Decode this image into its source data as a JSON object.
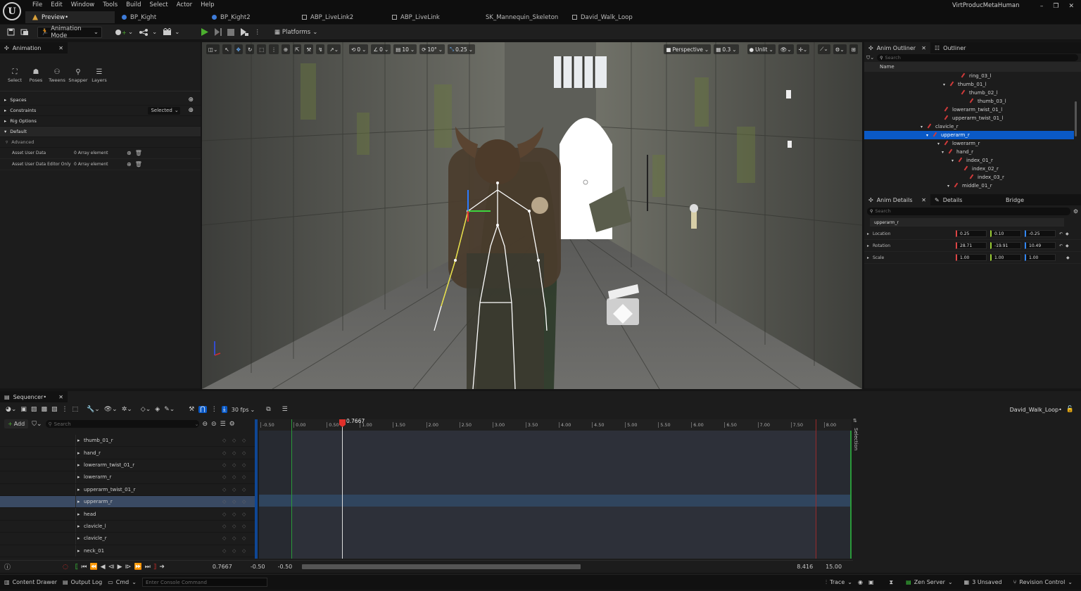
{
  "window": {
    "title": "VirtProducMetaHuman"
  },
  "menu": [
    "File",
    "Edit",
    "Window",
    "Tools",
    "Build",
    "Select",
    "Actor",
    "Help"
  ],
  "tabs": [
    {
      "label": "Preview•"
    },
    {
      "label": "BP_Kight"
    },
    {
      "label": "BP_Kight2"
    },
    {
      "label": "ABP_LiveLink2"
    },
    {
      "label": "ABP_LiveLink"
    },
    {
      "label": "SK_Mannequin_Skeleton"
    },
    {
      "label": "David_Walk_Loop"
    }
  ],
  "toolbar": {
    "mode_label": "Animation Mode",
    "platforms_label": "Platforms"
  },
  "animation_panel": {
    "tab_label": "Animation",
    "tools": [
      {
        "label": "Select"
      },
      {
        "label": "Poses"
      },
      {
        "label": "Tweens"
      },
      {
        "label": "Snapper"
      },
      {
        "label": "Layers"
      }
    ],
    "sections": {
      "spaces": "Spaces",
      "constraints": "Constraints",
      "constraints_value": "Selected",
      "rig_options": "Rig Options",
      "default": "Default",
      "advanced": "Advanced"
    },
    "props": [
      {
        "name": "Asset User Data",
        "value": "0 Array element"
      },
      {
        "name": "Asset User Data Editor Only",
        "value": "0 Array element"
      }
    ]
  },
  "viewport": {
    "perspective_label": "Perspective",
    "lit_label": "Unlit",
    "snap_translate": "10",
    "snap_rotate": "10°",
    "snap_scale": "0.25",
    "camera_speed": "0.3",
    "rotation_snap_label": "0"
  },
  "anim_outliner": {
    "tab_label": "Anim Outliner",
    "tab2_label": "Outliner",
    "search_placeholder": "Search",
    "column": "Name",
    "items": [
      {
        "label": "ring_03_l"
      },
      {
        "label": "thumb_01_l"
      },
      {
        "label": "thumb_02_l"
      },
      {
        "label": "thumb_03_l"
      },
      {
        "label": "lowerarm_twist_01_l"
      },
      {
        "label": "upperarm_twist_01_l"
      },
      {
        "label": "clavicle_r"
      },
      {
        "label": "upperarm_r"
      },
      {
        "label": "lowerarm_r"
      },
      {
        "label": "hand_r"
      },
      {
        "label": "index_01_r"
      },
      {
        "label": "index_02_r"
      },
      {
        "label": "index_03_r"
      },
      {
        "label": "middle_01_r"
      }
    ]
  },
  "anim_details": {
    "tab_label": "Anim Details",
    "tab2_label": "Details",
    "tab3_label": "Bridge",
    "search_placeholder": "Search",
    "selected": "upperarm_r",
    "rows": [
      {
        "label": "Location",
        "x": "0.25",
        "y": "0.10",
        "z": "-0.25"
      },
      {
        "label": "Rotation",
        "x": "28.71",
        "y": "-19.91",
        "z": "10.49"
      },
      {
        "label": "Scale",
        "x": "1.00",
        "y": "1.00",
        "z": "1.00"
      }
    ]
  },
  "sequencer": {
    "tab_label": "Sequencer•",
    "add_label": "Add",
    "search_placeholder": "Search",
    "fps_label": "30 fps",
    "sequence_name": "David_Walk_Loop•",
    "playhead": "0.7667",
    "current_time": "0.7667",
    "range_start": "-0.50",
    "range_start2": "-0.50",
    "range_end": "8.416",
    "range_end2": "15.00",
    "selection_label": "Selection",
    "ticks": [
      "-0.50",
      "0.00",
      "0.50",
      "1.00",
      "1.50",
      "2.00",
      "2.50",
      "3.00",
      "3.50",
      "4.00",
      "4.50",
      "5.00",
      "5.50",
      "6.00",
      "6.50",
      "7.00",
      "7.50",
      "8.00"
    ],
    "tracks": [
      {
        "label": "thumb_01_r"
      },
      {
        "label": "hand_r"
      },
      {
        "label": "lowerarm_twist_01_r"
      },
      {
        "label": "lowerarm_r"
      },
      {
        "label": "upperarm_twist_01_r"
      },
      {
        "label": "upperarm_r"
      },
      {
        "label": "head"
      },
      {
        "label": "clavicle_l"
      },
      {
        "label": "clavicle_r"
      },
      {
        "label": "neck_01"
      }
    ]
  },
  "statusbar": {
    "content_drawer": "Content Drawer",
    "output_log": "Output Log",
    "cmd": "Cmd",
    "console_placeholder": "Enter Console Command",
    "trace": "Trace",
    "zen_server": "Zen Server",
    "unsaved": "3 Unsaved",
    "revision_control": "Revision Control"
  },
  "colors": {
    "accent": "#0a59c6",
    "play_green": "#4caf2f",
    "playhead_red": "#e0302a",
    "selected_track": "#3a4a63"
  }
}
